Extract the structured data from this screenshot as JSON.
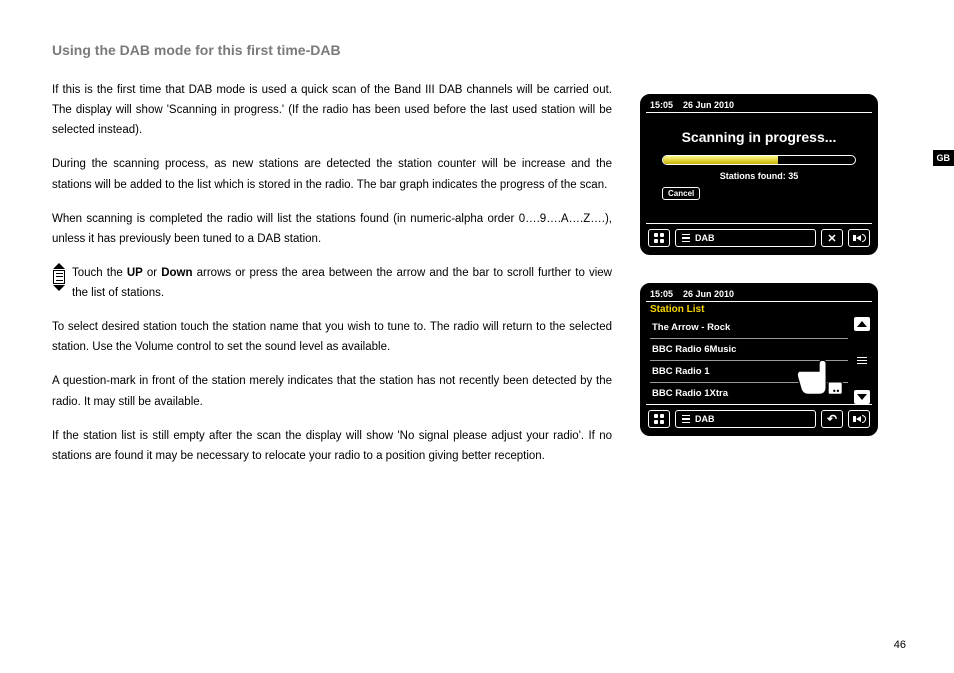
{
  "title": "Using the DAB mode for this first time-DAB",
  "side_tab": "GB",
  "page_number": "46",
  "paragraphs": {
    "p1": "If this is the first time that DAB mode is used a quick scan of the Band III DAB channels will be carried out. The display will show 'Scanning in progress.' (If the radio has been used before the last used station will be selected instead).",
    "p2": "During the scanning process, as new stations are detected the station counter will be increase and the stations will be added to the list which is stored in the radio. The bar graph indicates the progress of the scan.",
    "p3": "When scanning is completed the radio will list the stations found (in numeric-alpha order 0….9….A….Z….), unless it has previously been tuned to a DAB station.",
    "p4_pre": "Touch the ",
    "p4_up": "UP",
    "p4_mid": " or ",
    "p4_down": "Down",
    "p4_post": " arrows or press the area between the arrow and the bar to scroll further to view the list of stations.",
    "p5": "To select desired station touch the station name that you wish to tune to. The radio will return to the selected station. Use the Volume control to set the sound level as available.",
    "p6": "A question-mark in front of the station merely indicates that the station has not recently been detected by the radio. It may still be available.",
    "p7": "If the station list is still empty after the scan the display will show 'No signal please adjust your radio'. If no stations are found it may be necessary to relocate your radio to a position giving better reception."
  },
  "radio1": {
    "time": "15:05",
    "date": "26 Jun 2010",
    "scan_title": "Scanning in progress...",
    "stations_found": "Stations found: 35",
    "cancel": "Cancel",
    "mode": "DAB"
  },
  "radio2": {
    "time": "15:05",
    "date": "26 Jun 2010",
    "header": "Station List",
    "items": [
      "The Arrow - Rock",
      "BBC Radio 6Music",
      "BBC Radio 1",
      "BBC Radio 1Xtra"
    ],
    "mode": "DAB"
  }
}
